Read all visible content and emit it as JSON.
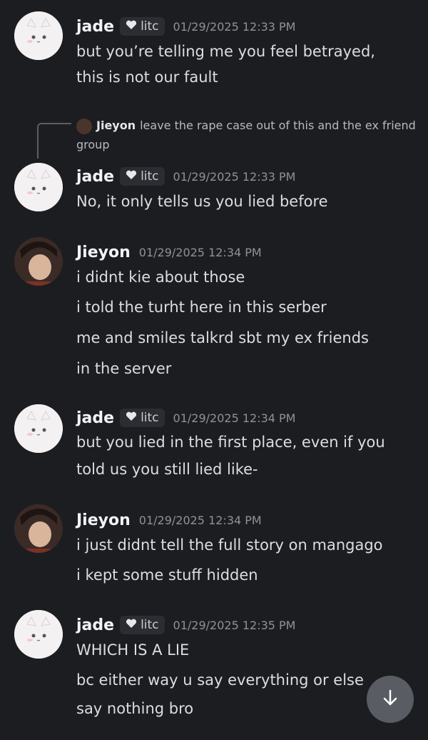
{
  "messages": [
    {
      "author": "jade",
      "badge": "litc",
      "timestamp": "01/29/2025 12:33 PM",
      "lines": [
        "but you’re telling me you feel betrayed,",
        "this is not our fault"
      ]
    },
    {
      "reply": {
        "author": "Jieyon",
        "text": "leave the rape case out of this and the ex friend group"
      },
      "author": "jade",
      "badge": "litc",
      "timestamp": "01/29/2025 12:33 PM",
      "lines": [
        "No, it only tells us you lied before"
      ]
    },
    {
      "author": "Jieyon",
      "timestamp": "01/29/2025 12:34 PM",
      "lines": [
        "i didnt kie about those",
        "i told the turht here in this serber",
        "me and smiles talkrd sbt my ex friends",
        "in the server"
      ]
    },
    {
      "author": "jade",
      "badge": "litc",
      "timestamp": "01/29/2025 12:34 PM",
      "lines": [
        "but you lied in the first place, even if you",
        "told us you still lied like-"
      ]
    },
    {
      "author": "Jieyon",
      "timestamp": "01/29/2025 12:34 PM",
      "lines": [
        "i just didnt tell the full story on mangago",
        "i kept some stuff hidden"
      ]
    },
    {
      "author": "jade",
      "badge": "litc",
      "timestamp": "01/29/2025 12:35 PM",
      "lines": [
        "WHICH IS A LIE",
        "bc either way u say everything or else",
        "say nothing bro"
      ]
    }
  ],
  "icons": {
    "badge": "heart-icon",
    "scroll": "arrow-down-icon"
  },
  "colors": {
    "background": "#1c1d21",
    "badge_bg": "#2c2d32",
    "timestamp": "#8e9297"
  }
}
